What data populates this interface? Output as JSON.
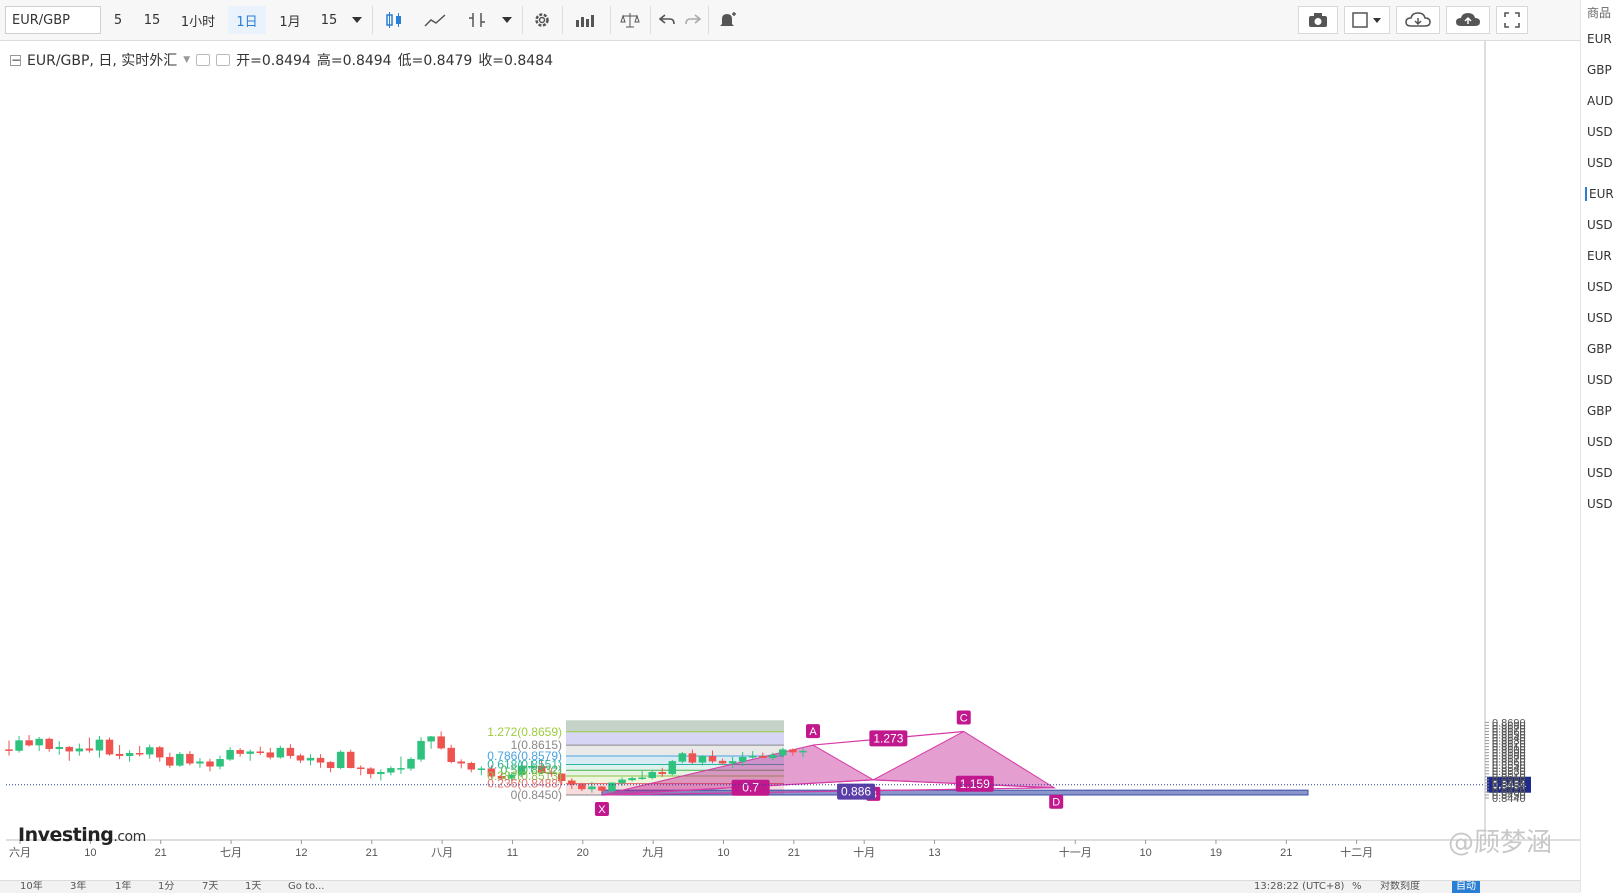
{
  "toolbar": {
    "symbol": "EUR/GBP",
    "intervals": [
      "5",
      "15",
      "1小时",
      "1日",
      "1月",
      "15"
    ],
    "active_interval": "1日"
  },
  "legend": {
    "title": "EUR/GBP, 日, 实时外汇",
    "open": "开=0.8494",
    "high": "高=0.8494",
    "low": "低=0.8479",
    "close": "收=0.8484"
  },
  "right_panel": {
    "header": "商品",
    "items": [
      "EUR",
      "GBP",
      "AUD",
      "USD",
      "USD",
      "EUR",
      "USD",
      "EUR",
      "USD",
      "USD",
      "GBP",
      "USD",
      "GBP",
      "USD",
      "USD",
      "USD"
    ]
  },
  "bottom_bar": {
    "ranges": [
      "10年",
      "3年",
      "1年",
      "1分",
      "7天",
      "1天",
      "Go to..."
    ],
    "time": "13:28:22 (UTC+8)",
    "percent": "%",
    "log": "对数刻度",
    "auto": "自动"
  },
  "logo": {
    "main": "Investing",
    "suffix": ".com"
  },
  "watermark": "@顾梦涵",
  "chart_data": {
    "type": "candlestick",
    "symbol": "EUR/GBP",
    "ylim": [
      0.844,
      0.8697
    ],
    "price_ticks": [
      "0.8690",
      "0.8680",
      "0.8670",
      "0.8660",
      "0.8650",
      "0.8640",
      "0.8630",
      "0.8620",
      "0.8610",
      "0.8600",
      "0.8590",
      "0.8580",
      "0.8570",
      "0.8560",
      "0.8550",
      "0.8540",
      "0.8530",
      "0.8520",
      "0.8510",
      "0.8500",
      "0.8490",
      "0.8480",
      "0.8470",
      "0.8460",
      "0.8450",
      "0.8440"
    ],
    "current_price": "0.8484",
    "time_ticks": [
      {
        "label": "六月",
        "i": 0
      },
      {
        "label": "10",
        "i": 7
      },
      {
        "label": "21",
        "i": 14
      },
      {
        "label": "七月",
        "i": 21
      },
      {
        "label": "12",
        "i": 28
      },
      {
        "label": "21",
        "i": 35
      },
      {
        "label": "八月",
        "i": 42
      },
      {
        "label": "11",
        "i": 49
      },
      {
        "label": "20",
        "i": 56
      },
      {
        "label": "九月",
        "i": 63
      },
      {
        "label": "10",
        "i": 70
      },
      {
        "label": "21",
        "i": 77
      },
      {
        "label": "十月",
        "i": 84
      },
      {
        "label": "13",
        "i": 91
      },
      {
        "label": "十一月",
        "i": 105
      },
      {
        "label": "10",
        "i": 112
      },
      {
        "label": "19",
        "i": 119
      },
      {
        "label": "21",
        "i": 126
      },
      {
        "label": "十二月",
        "i": 133
      }
    ],
    "candles": [
      [
        0.86,
        0.863,
        0.858,
        0.8597
      ],
      [
        0.8597,
        0.8645,
        0.859,
        0.863
      ],
      [
        0.863,
        0.8648,
        0.861,
        0.8615
      ],
      [
        0.8615,
        0.8642,
        0.8595,
        0.8635
      ],
      [
        0.8635,
        0.864,
        0.8593,
        0.8603
      ],
      [
        0.8603,
        0.8628,
        0.8583,
        0.8608
      ],
      [
        0.8608,
        0.8612,
        0.8563,
        0.8595
      ],
      [
        0.8595,
        0.862,
        0.858,
        0.8603
      ],
      [
        0.8603,
        0.864,
        0.859,
        0.8598
      ],
      [
        0.8598,
        0.8645,
        0.8573,
        0.8632
      ],
      [
        0.8632,
        0.864,
        0.858,
        0.8585
      ],
      [
        0.8585,
        0.8615,
        0.8568,
        0.858
      ],
      [
        0.858,
        0.8598,
        0.856,
        0.8588
      ],
      [
        0.8588,
        0.8612,
        0.8577,
        0.8585
      ],
      [
        0.8585,
        0.8617,
        0.857,
        0.8607
      ],
      [
        0.8607,
        0.8612,
        0.856,
        0.8575
      ],
      [
        0.8575,
        0.859,
        0.854,
        0.8548
      ],
      [
        0.8548,
        0.8592,
        0.8543,
        0.8585
      ],
      [
        0.8585,
        0.8595,
        0.8548,
        0.8555
      ],
      [
        0.8555,
        0.8572,
        0.854,
        0.856
      ],
      [
        0.856,
        0.857,
        0.8528,
        0.8545
      ],
      [
        0.8545,
        0.858,
        0.8535,
        0.8568
      ],
      [
        0.8568,
        0.8608,
        0.8563,
        0.8598
      ],
      [
        0.8598,
        0.8605,
        0.8577,
        0.8587
      ],
      [
        0.8587,
        0.86,
        0.8563,
        0.8593
      ],
      [
        0.8593,
        0.861,
        0.8582,
        0.859
      ],
      [
        0.859,
        0.8606,
        0.8568,
        0.8575
      ],
      [
        0.8575,
        0.8613,
        0.857,
        0.8605
      ],
      [
        0.8605,
        0.8618,
        0.857,
        0.858
      ],
      [
        0.858,
        0.8586,
        0.8556,
        0.8565
      ],
      [
        0.8565,
        0.8585,
        0.8548,
        0.8572
      ],
      [
        0.8572,
        0.8585,
        0.854,
        0.8558
      ],
      [
        0.8558,
        0.8562,
        0.8525,
        0.854
      ],
      [
        0.854,
        0.8598,
        0.8535,
        0.8592
      ],
      [
        0.8592,
        0.86,
        0.8538,
        0.854
      ],
      [
        0.854,
        0.8548,
        0.8515,
        0.8537
      ],
      [
        0.8537,
        0.8542,
        0.8505,
        0.852
      ],
      [
        0.852,
        0.8535,
        0.8498,
        0.8525
      ],
      [
        0.8525,
        0.8545,
        0.8515,
        0.8538
      ],
      [
        0.8538,
        0.8577,
        0.852,
        0.8538
      ],
      [
        0.8538,
        0.8575,
        0.853,
        0.8568
      ],
      [
        0.8568,
        0.8641,
        0.856,
        0.8628
      ],
      [
        0.8628,
        0.8645,
        0.8603,
        0.8643
      ],
      [
        0.8643,
        0.866,
        0.86,
        0.8605
      ],
      [
        0.8605,
        0.8616,
        0.8555,
        0.856
      ],
      [
        0.856,
        0.8568,
        0.8538,
        0.8555
      ],
      [
        0.8555,
        0.856,
        0.8525,
        0.8535
      ],
      [
        0.8535,
        0.8545,
        0.8515,
        0.8537
      ],
      [
        0.8537,
        0.8548,
        0.8505,
        0.8512
      ],
      [
        0.8512,
        0.8522,
        0.85,
        0.8505
      ],
      [
        0.8505,
        0.852,
        0.8495,
        0.8517
      ],
      [
        0.8517,
        0.856,
        0.851,
        0.8545
      ],
      [
        0.8545,
        0.8564,
        0.8525,
        0.8545
      ],
      [
        0.8545,
        0.8565,
        0.852,
        0.8523
      ],
      [
        0.8523,
        0.854,
        0.851,
        0.852
      ],
      [
        0.852,
        0.8522,
        0.8485,
        0.8497
      ],
      [
        0.8497,
        0.8505,
        0.847,
        0.8485
      ],
      [
        0.8485,
        0.849,
        0.8463,
        0.847
      ],
      [
        0.847,
        0.8493,
        0.8458,
        0.8477
      ],
      [
        0.8477,
        0.848,
        0.8459,
        0.8465
      ],
      [
        0.8465,
        0.8492,
        0.8455,
        0.849
      ],
      [
        0.849,
        0.8508,
        0.848,
        0.85
      ],
      [
        0.85,
        0.851,
        0.8495,
        0.8505
      ],
      [
        0.8505,
        0.853,
        0.85,
        0.8507
      ],
      [
        0.8507,
        0.8532,
        0.8502,
        0.8525
      ],
      [
        0.8525,
        0.854,
        0.851,
        0.852
      ],
      [
        0.852,
        0.8566,
        0.8515,
        0.8561
      ],
      [
        0.8561,
        0.8592,
        0.8555,
        0.8587
      ],
      [
        0.8587,
        0.86,
        0.8553,
        0.8558
      ],
      [
        0.8558,
        0.8582,
        0.8548,
        0.8578
      ],
      [
        0.8578,
        0.8597,
        0.8555,
        0.8562
      ],
      [
        0.8562,
        0.857,
        0.855,
        0.8555
      ],
      [
        0.8555,
        0.8576,
        0.854,
        0.8561
      ],
      [
        0.8561,
        0.8592,
        0.8545,
        0.8575
      ],
      [
        0.8575,
        0.8595,
        0.857,
        0.8578
      ],
      [
        0.8578,
        0.859,
        0.8573,
        0.8573
      ],
      [
        0.8573,
        0.859,
        0.8565,
        0.8582
      ],
      [
        0.8582,
        0.8606,
        0.8573,
        0.86
      ],
      [
        0.86,
        0.8604,
        0.858,
        0.8592
      ],
      [
        0.8592,
        0.8604,
        0.8575,
        0.8595
      ]
    ],
    "fibonacci": {
      "levels": [
        {
          "label": "1.272(0.8659)",
          "value": 0.8659,
          "color": "#9ccc3c",
          "fill": "#c5d2c7"
        },
        {
          "label": "1(0.8615)",
          "value": 0.8615,
          "color": "#888888",
          "fill": "#d6d5f5"
        },
        {
          "label": "0.786(0.8579)",
          "value": 0.8579,
          "color": "#4aa3df",
          "fill": "#e9e9e9"
        },
        {
          "label": "0.618(0.8551)",
          "value": 0.8551,
          "color": "#2bb3a3",
          "fill": "#d8ebf5"
        },
        {
          "label": "0.5(0.8532)",
          "value": 0.8532,
          "color": "#4caf50",
          "fill": "#dff3ee"
        },
        {
          "label": "0.382(0.8513)",
          "value": 0.8513,
          "color": "#8bc34a",
          "fill": "#e6f5e3"
        },
        {
          "label": "0.236(0.8488)",
          "value": 0.8488,
          "color": "#e57373",
          "fill": "#eef5da"
        },
        {
          "label": "0(0.8450)",
          "value": 0.845,
          "color": "#888888",
          "fill": "#f6dcdc"
        }
      ],
      "top": 0.8697
    },
    "harmonic_pattern": {
      "points": [
        {
          "label": "X",
          "i": 59,
          "value": 0.845
        },
        {
          "label": "A",
          "i": 80,
          "value": 0.8615
        },
        {
          "label": "B",
          "i": 86,
          "value": 0.85
        },
        {
          "label": "C",
          "i": 95,
          "value": 0.866
        },
        {
          "label": "D",
          "i": 104,
          "value": 0.8474
        }
      ],
      "ratios": [
        {
          "label": "1.273",
          "value": 0.8637
        },
        {
          "label": "0.7",
          "value": 0.8474
        },
        {
          "label": "1.159",
          "value": 0.8487
        },
        {
          "label": "0.886",
          "value": 0.8461
        }
      ]
    }
  }
}
